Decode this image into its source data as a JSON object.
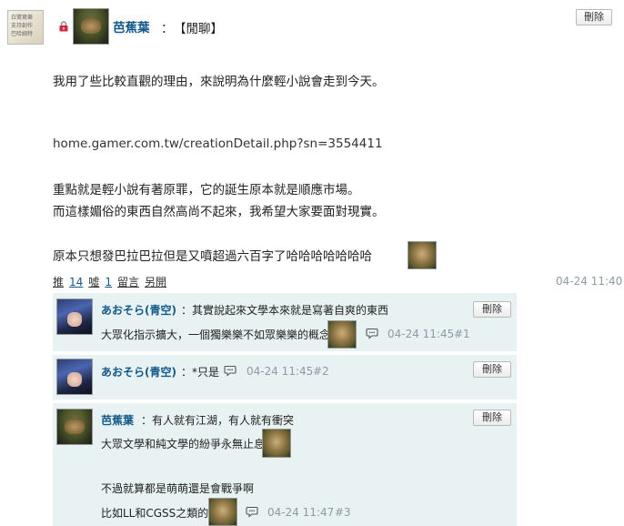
{
  "post": {
    "author": "芭蕉葉",
    "colon": "：",
    "category": "【閒聊】",
    "delete_label": "刪除",
    "time": "04-24 11:40",
    "lines": [
      "我用了些比較直觀的理由，來說明為什麼輕小說會走到今天。",
      "home.gamer.com.tw/creationDetail.php?sn=3554411",
      "重點就是輕小說有著原罪，它的誕生原本就是順應市場。",
      "而這樣媚俗的東西自然高尚不起來，我希望大家要面對現實。",
      "原本只想發巴拉巴拉但是又噴超過六百字了哈哈哈哈哈哈哈"
    ],
    "thumb_text": [
      "白鷺鷥樂",
      "支持創作",
      "巴哈姆特"
    ]
  },
  "actions": {
    "push_label": "推",
    "push_count": "14",
    "boo_label": "噓",
    "boo_count": "1",
    "reply_label": "留言",
    "share_label": "另開"
  },
  "comments": [
    {
      "author": "あおそら(青空)",
      "lines": [
        "：其實說起來文學本來就是寫著自爽的東西",
        "大眾化指示擴大，一個獨樂樂不如眾樂樂的概念"
      ],
      "time": "04-24 11:45",
      "floor": "#1",
      "delete_label": "刪除",
      "avatar": "anime-avatar"
    },
    {
      "author": "あおそら(青空)",
      "lines": [
        "：*只是"
      ],
      "time": "04-24 11:45",
      "floor": "#2",
      "delete_label": "刪除",
      "avatar": "anime-avatar"
    },
    {
      "author": "芭蕉葉",
      "lines": [
        "：有人就有江湖，有人就有衝突",
        "大眾文學和純文學的紛爭永無止息",
        "不過就算都是萌萌還是會戰爭啊",
        "比如LL和CGSS之類的"
      ],
      "time": "04-24 11:47",
      "floor": "#3",
      "delete_label": "刪除",
      "avatar": "face-avatar"
    }
  ],
  "colors": {
    "author_link": "#125a8c",
    "comment_bg": "#e8f2f2",
    "timestamp": "#8e9aa4"
  },
  "icons": [
    "lock-icon",
    "speech-bubble-icon",
    "emoticon"
  ]
}
